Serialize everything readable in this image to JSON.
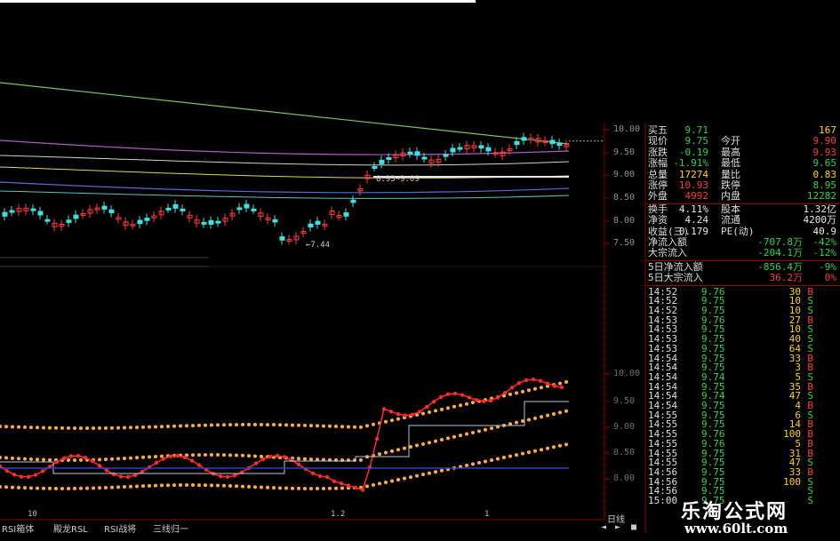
{
  "price_axis": [
    "10.00",
    "9.50",
    "9.00",
    "8.50",
    "8.00",
    "7.50"
  ],
  "indicator_axis": [
    "10.00",
    "9.50",
    "9.00",
    "8.50",
    "8.00"
  ],
  "chart_annotations": {
    "range_label": "8.93~9.09",
    "low_label": "←7.44"
  },
  "x_axis_labels": [
    "10",
    "1.2",
    "1"
  ],
  "quote": {
    "rows": [
      {
        "k1": "买五",
        "v1": "9.71",
        "v1c": "grn",
        "k2": "",
        "v2": "167",
        "v2c": "yel"
      },
      {
        "k1": "现价",
        "v1": "9.75",
        "v1c": "grn",
        "k2": "今开",
        "v2": "9.90",
        "v2c": "red"
      },
      {
        "k1": "涨跌",
        "v1": "-0.19",
        "v1c": "grn",
        "k2": "最高",
        "v2": "9.93",
        "v2c": "red"
      },
      {
        "k1": "涨幅",
        "v1": "-1.91%",
        "v1c": "grn",
        "k2": "最低",
        "v2": "9.65",
        "v2c": "grn"
      },
      {
        "k1": "总量",
        "v1": "17274",
        "v1c": "yel",
        "k2": "量比",
        "v2": "0.83",
        "v2c": "yel"
      },
      {
        "k1": "涨停",
        "v1": "10.93",
        "v1c": "red",
        "k2": "跌停",
        "v2": "8.95",
        "v2c": "grn"
      },
      {
        "k1": "外盘",
        "v1": "4992",
        "v1c": "red",
        "k2": "内盘",
        "v2": "12282",
        "v2c": "grn"
      }
    ],
    "rows2": [
      {
        "k1": "换手",
        "v1": "4.11%",
        "v1c": "wht",
        "k2": "股本",
        "v2": "1.32亿",
        "v2c": "wht"
      },
      {
        "k1": "净资",
        "v1": "4.24",
        "v1c": "wht",
        "k2": "流通",
        "v2": "4200万",
        "v2c": "wht"
      },
      {
        "k1": "收益(三)",
        "v1": "0.179",
        "v1c": "wht",
        "k2": "PE(动)",
        "v2": "40.9",
        "v2c": "wht"
      }
    ],
    "flows": [
      {
        "k": "净流入额",
        "v1": "-707.8万",
        "v2": "-42%"
      },
      {
        "k": "大宗流入",
        "v1": "-204.1万",
        "v2": "-12%"
      }
    ],
    "flows5": [
      {
        "k": "5日净流入额",
        "v1": "-856.4万",
        "v2": "-9%"
      },
      {
        "k": "5日大宗流入",
        "v1": "36.2万",
        "v2": "0%"
      }
    ]
  },
  "ticks": [
    [
      "14:52",
      "9.76",
      "30",
      "B"
    ],
    [
      "14:52",
      "9.75",
      "10",
      "S"
    ],
    [
      "14:52",
      "9.75",
      "10",
      "S"
    ],
    [
      "14:53",
      "9.76",
      "27",
      "B"
    ],
    [
      "14:53",
      "9.75",
      "10",
      "S"
    ],
    [
      "14:53",
      "9.75",
      "40",
      "S"
    ],
    [
      "14:53",
      "9.75",
      "64",
      "S"
    ],
    [
      "14:54",
      "9.75",
      "33",
      "B"
    ],
    [
      "14:54",
      "9.75",
      "3",
      "B"
    ],
    [
      "14:54",
      "9.74",
      "5",
      "S"
    ],
    [
      "14:54",
      "9.75",
      "35",
      "B"
    ],
    [
      "14:54",
      "9.74",
      "47",
      "S"
    ],
    [
      "14:54",
      "9.75",
      "4",
      "B"
    ],
    [
      "14:55",
      "9.75",
      "6",
      "S"
    ],
    [
      "14:55",
      "9.75",
      "14",
      "B"
    ],
    [
      "14:55",
      "9.76",
      "100",
      "B"
    ],
    [
      "14:55",
      "9.76",
      "5",
      "B"
    ],
    [
      "14:55",
      "9.75",
      "31",
      "B"
    ],
    [
      "14:55",
      "9.75",
      "47",
      "S"
    ],
    [
      "14:56",
      "9.75",
      "33",
      "B"
    ],
    [
      "14:56",
      "9.75",
      "100",
      "S"
    ],
    [
      "14:56",
      "9.75",
      "",
      "S"
    ],
    [
      "15:00",
      "9.75",
      "",
      "S"
    ]
  ],
  "tabs": [
    "RSI箱体",
    "殿龙RSL",
    "RSI战将",
    "三线归一"
  ],
  "period_label": "日线",
  "nav": [
    "◄",
    "►",
    "■"
  ],
  "watermark": {
    "title": "乐淘公式网",
    "url": "www.60lt.com"
  },
  "colors": {
    "up": "#ff3b3b",
    "down": "#2fd34a",
    "volume": "#ffd400",
    "bg": "#000000",
    "grid": "#8b0000"
  }
}
